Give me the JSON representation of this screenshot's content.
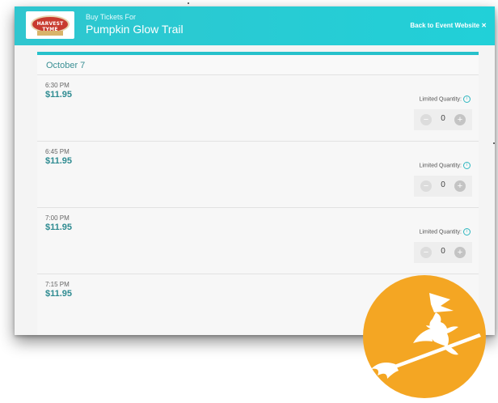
{
  "header": {
    "subtitle": "Buy Tickets For",
    "event_title": "Pumpkin Glow Trail",
    "back_link": "Back to Event Website ✕",
    "logo_text": "HARVEST TYME"
  },
  "date_label": "October 7",
  "slots": [
    {
      "time": "6:30 PM",
      "price": "$11.95",
      "limited_label": "Limited Quantity:",
      "quantity": "0",
      "minus": "−",
      "plus": "+"
    },
    {
      "time": "6:45 PM",
      "price": "$11.95",
      "limited_label": "Limited Quantity:",
      "quantity": "0",
      "minus": "−",
      "plus": "+"
    },
    {
      "time": "7:00 PM",
      "price": "$11.95",
      "limited_label": "Limited Quantity:",
      "quantity": "0",
      "minus": "−",
      "plus": "+"
    },
    {
      "time": "7:15 PM",
      "price": "$11.95"
    }
  ],
  "colors": {
    "header_bg": "#21d0d8",
    "price": "#2e8b91",
    "witch_bg": "#f4a623"
  },
  "icons": {
    "info": "info-icon",
    "witch": "witch-on-broom-icon"
  }
}
